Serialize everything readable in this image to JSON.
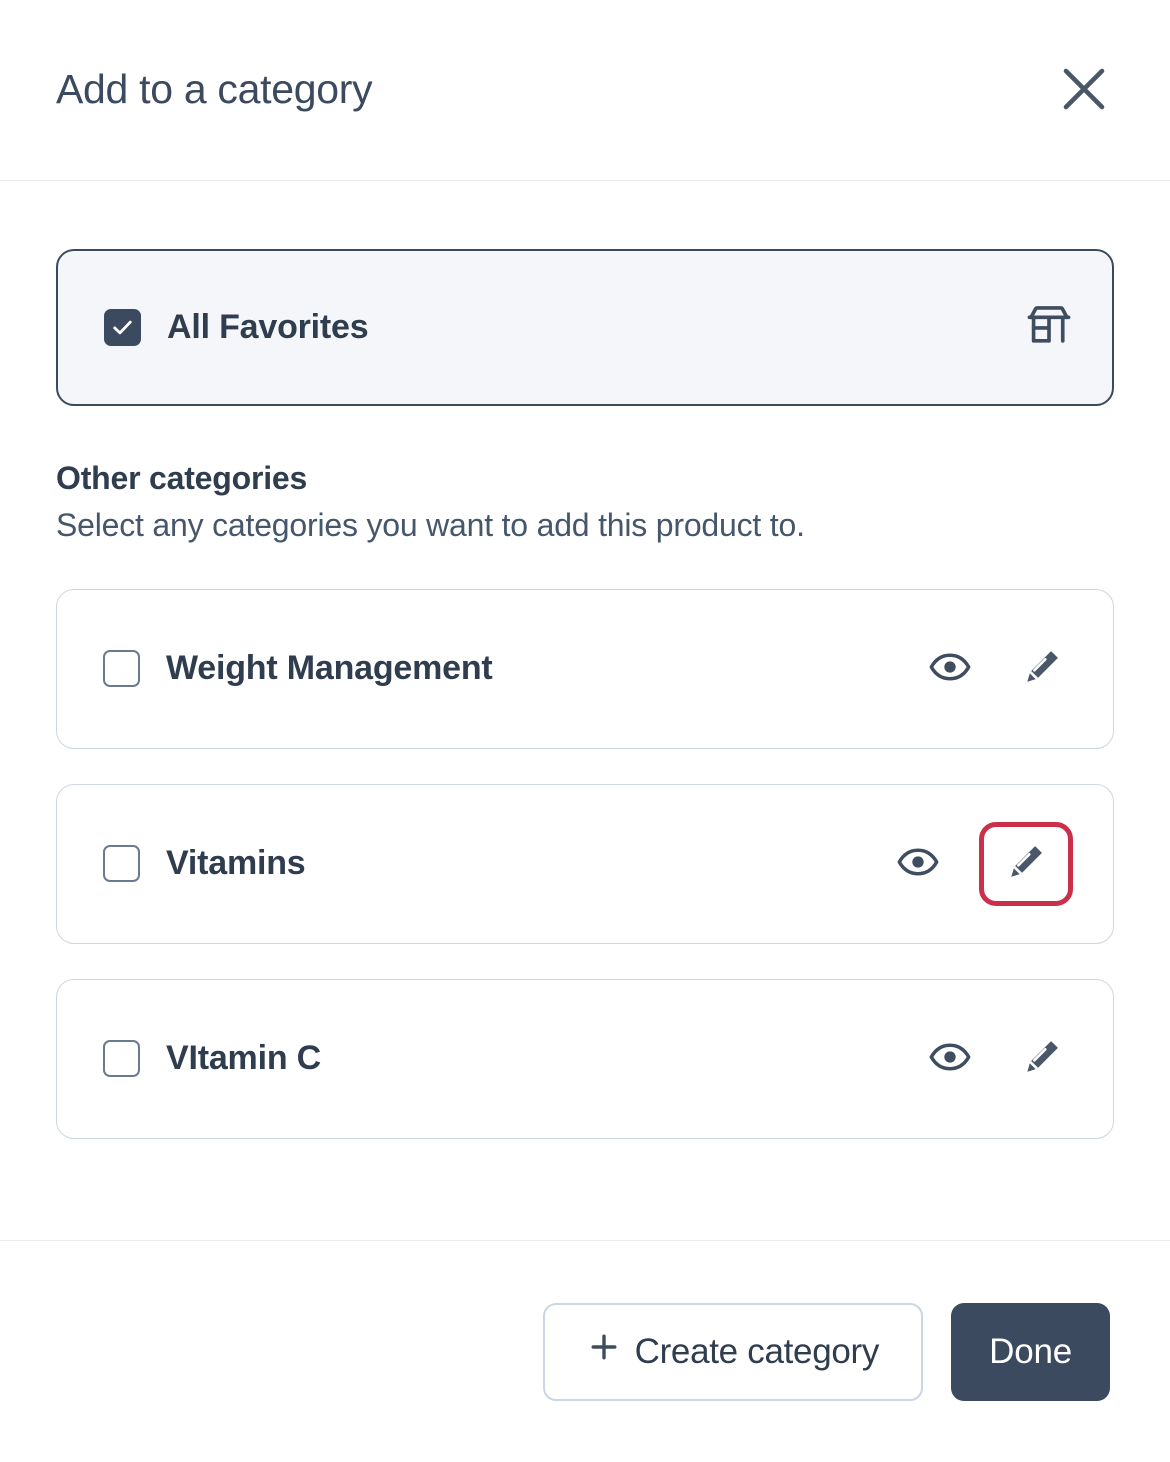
{
  "header": {
    "title": "Add to a category",
    "close_icon": "close-icon"
  },
  "favorites": {
    "label": "All Favorites",
    "checked": true,
    "icon": "storefront-icon"
  },
  "other_section": {
    "title": "Other categories",
    "subtitle": "Select any categories you want to add this product to."
  },
  "categories": [
    {
      "label": "Weight Management",
      "checked": false,
      "view_icon": "eye-icon",
      "edit_icon": "pencil-icon",
      "edit_highlighted": false
    },
    {
      "label": "Vitamins",
      "checked": false,
      "view_icon": "eye-icon",
      "edit_icon": "pencil-icon",
      "edit_highlighted": true
    },
    {
      "label": "VItamin C",
      "checked": false,
      "view_icon": "eye-icon",
      "edit_icon": "pencil-icon",
      "edit_highlighted": false
    }
  ],
  "footer": {
    "create_label": "Create category",
    "create_icon": "plus-icon",
    "done_label": "Done"
  },
  "colors": {
    "navy": "#3b4a5e",
    "highlight_red": "#ca3049",
    "card_bg": "#f4f6fa",
    "border": "#cdd6e0"
  }
}
